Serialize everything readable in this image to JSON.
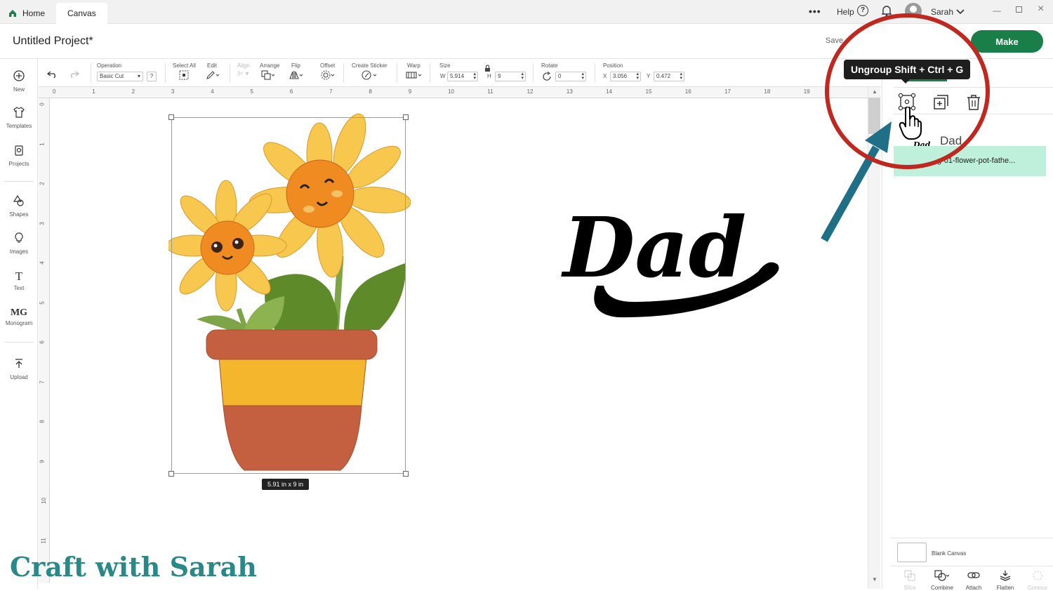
{
  "tabs": [
    {
      "label": "Home",
      "icon": "home-icon"
    },
    {
      "label": "Canvas"
    }
  ],
  "window_controls": {
    "more": "•••",
    "help_label": "Help",
    "user_name": "Sarah"
  },
  "project": {
    "title": "Untitled Project*",
    "save_label": "Save",
    "make_label": "Make"
  },
  "toolbar": {
    "operation_label": "Operation",
    "operation_value": "Basic Cut",
    "operation_help": "?",
    "select_all_label": "Select All",
    "edit_label": "Edit",
    "align_label": "Align",
    "arrange_label": "Arrange",
    "flip_label": "Flip",
    "offset_label": "Offset",
    "create_sticker_label": "Create Sticker",
    "warp_label": "Warp",
    "size_label": "Size",
    "size_w_label": "W",
    "size_w_value": "5.914",
    "size_h_label": "H",
    "size_h_value": "9",
    "rotate_label": "Rotate",
    "rotate_value": "0",
    "position_label": "Position",
    "position_x_label": "X",
    "position_x_value": "3.056",
    "position_y_label": "Y",
    "position_y_value": "0.472"
  },
  "left_nav": [
    {
      "label": "New",
      "icon": "plus-circle-icon"
    },
    {
      "label": "Templates",
      "icon": "shirt-icon"
    },
    {
      "label": "Projects",
      "icon": "projects-icon"
    },
    {
      "label": "Shapes",
      "icon": "shapes-icon"
    },
    {
      "label": "Images",
      "icon": "lightbulb-icon"
    },
    {
      "label": "Text",
      "icon": "text-icon"
    },
    {
      "label": "Monogram",
      "icon": "monogram-icon"
    },
    {
      "label": "Upload",
      "icon": "upload-icon"
    }
  ],
  "ruler": {
    "top": [
      "0",
      "1",
      "2",
      "3",
      "4",
      "5",
      "6",
      "7",
      "8",
      "9",
      "10",
      "11",
      "12",
      "13",
      "14",
      "15",
      "16",
      "17",
      "18",
      "19"
    ],
    "left": [
      "0",
      "1",
      "2",
      "3",
      "4",
      "5",
      "6",
      "7",
      "8",
      "9",
      "10",
      "11"
    ]
  },
  "canvas": {
    "selection_size": "5.91  in x 9  in",
    "dad_text": "Dad"
  },
  "tooltip": {
    "text": "Ungroup Shift + Ctrl + G"
  },
  "layers_panel": {
    "group_label": "Dad",
    "selected_layer_name": "g-01-flower-pot-fathe...",
    "blank_canvas_label": "Blank Canvas",
    "actions": [
      "ungroup-icon",
      "duplicate-icon",
      "trash-icon"
    ]
  },
  "bottom_tools": [
    {
      "label": "Slice",
      "icon": "slice-icon",
      "enabled": false
    },
    {
      "label": "Combine",
      "icon": "combine-icon",
      "enabled": true
    },
    {
      "label": "Attach",
      "icon": "attach-icon",
      "enabled": true
    },
    {
      "label": "Flatten",
      "icon": "flatten-icon",
      "enabled": true
    },
    {
      "label": "Contour",
      "icon": "contour-icon",
      "enabled": false
    }
  ],
  "watermark": {
    "text": "Craft with Sarah"
  },
  "colors": {
    "make_green": "#1a7e48",
    "highlight_circle": "#c0281f",
    "arrow_teal": "#1f6f86",
    "selected_layer_bg": "#bff0dc",
    "pot_rim": "#c45f3f",
    "pot_band": "#f3b62d",
    "petal": "#f7c84d",
    "flower_center": "#f08b22",
    "leaf": "#5f8a2a",
    "watermark": "#2a8888"
  }
}
